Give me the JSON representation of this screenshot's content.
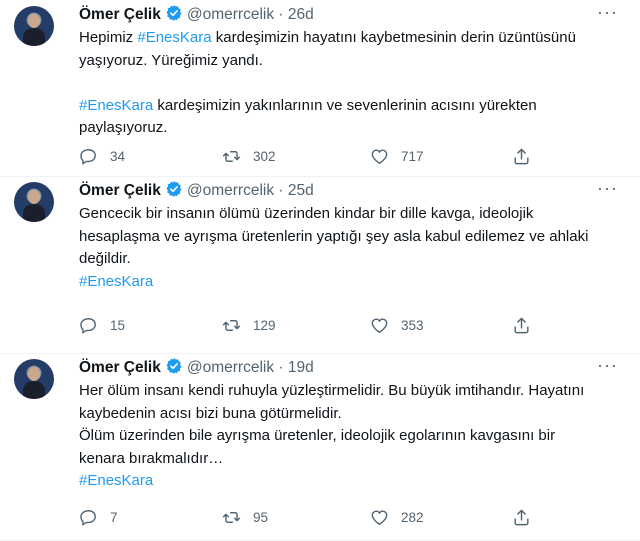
{
  "tweets": [
    {
      "name": "Ömer Çelik",
      "handle": "@omerrcelik",
      "separator": "·",
      "time": "26d",
      "more": "···",
      "lines": [
        [
          "Hepimiz ",
          "#EnesKara",
          " kardeşimizin hayatını kaybetmesinin derin üzüntüsünü"
        ],
        [
          "yaşıyoruz. Yüreğimiz yandı."
        ],
        [],
        [
          "",
          "#EnesKara",
          " kardeşimizin yakınlarının ve sevenlerinin acısını yürekten"
        ],
        [
          "paylaşıyoruz."
        ]
      ],
      "replies": "34",
      "retweets": "302",
      "likes": "717"
    },
    {
      "name": "Ömer Çelik",
      "handle": "@omerrcelik",
      "separator": "·",
      "time": "25d",
      "more": "···",
      "lines": [
        [
          "Gencecik bir insanın ölümü üzerinden kindar bir dille kavga, ideolojik"
        ],
        [
          "hesaplaşma ve ayrışma üretenlerin yaptığı şey asla kabul edilemez ve ahlaki"
        ],
        [
          "değildir."
        ],
        [
          "",
          "#EnesKara",
          ""
        ]
      ],
      "replies": "15",
      "retweets": "129",
      "likes": "353"
    },
    {
      "name": "Ömer Çelik",
      "handle": "@omerrcelik",
      "separator": "·",
      "time": "19d",
      "more": "···",
      "lines": [
        [
          "Her ölüm insanı kendi ruhuyla yüzleştirmelidir. Bu büyük imtihandır. Hayatını"
        ],
        [
          "kaybedenin acısı bizi buna götürmelidir."
        ],
        [
          "Ölüm üzerinden bile ayrışma üretenler, ideolojik egolarının kavgasını bir"
        ],
        [
          "kenara bırakmalıdır…"
        ],
        [
          "",
          "#EnesKara",
          ""
        ]
      ],
      "replies": "7",
      "retweets": "95",
      "likes": "282"
    }
  ],
  "icons": {
    "verified": "verified-badge-icon",
    "reply": "reply-icon",
    "retweet": "retweet-icon",
    "like": "heart-icon",
    "share": "share-icon"
  },
  "colors": {
    "hashtag": "#1d9bf0",
    "secondary": "#536471",
    "text": "#0f1419"
  }
}
